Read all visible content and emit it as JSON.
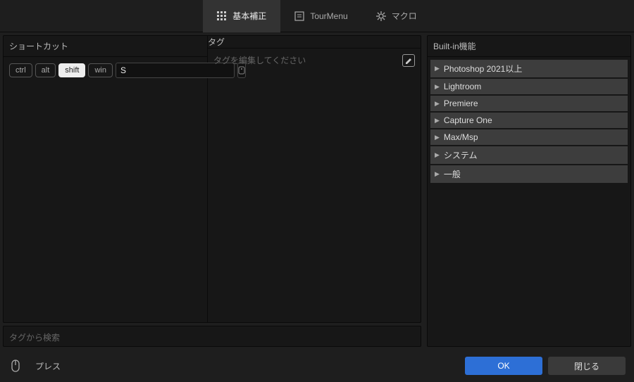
{
  "tabs": {
    "basic": "基本補正",
    "tourmenu": "TourMenu",
    "macro": "マクロ"
  },
  "shortcut": {
    "header": "ショートカット",
    "keys": {
      "ctrl": "ctrl",
      "alt": "alt",
      "shift": "shift",
      "win": "win"
    },
    "input_value": "S"
  },
  "tag": {
    "header": "タグ",
    "placeholder": "タグを編集してください"
  },
  "search": {
    "placeholder": "タグから検索"
  },
  "builtin": {
    "header": "Built-in機能",
    "items": [
      "Photoshop 2021以上",
      "Lightroom",
      "Premiere",
      "Capture One",
      "Max/Msp",
      "システム",
      "一般"
    ]
  },
  "footer": {
    "press": "プレス",
    "ok": "OK",
    "close": "閉じる"
  }
}
